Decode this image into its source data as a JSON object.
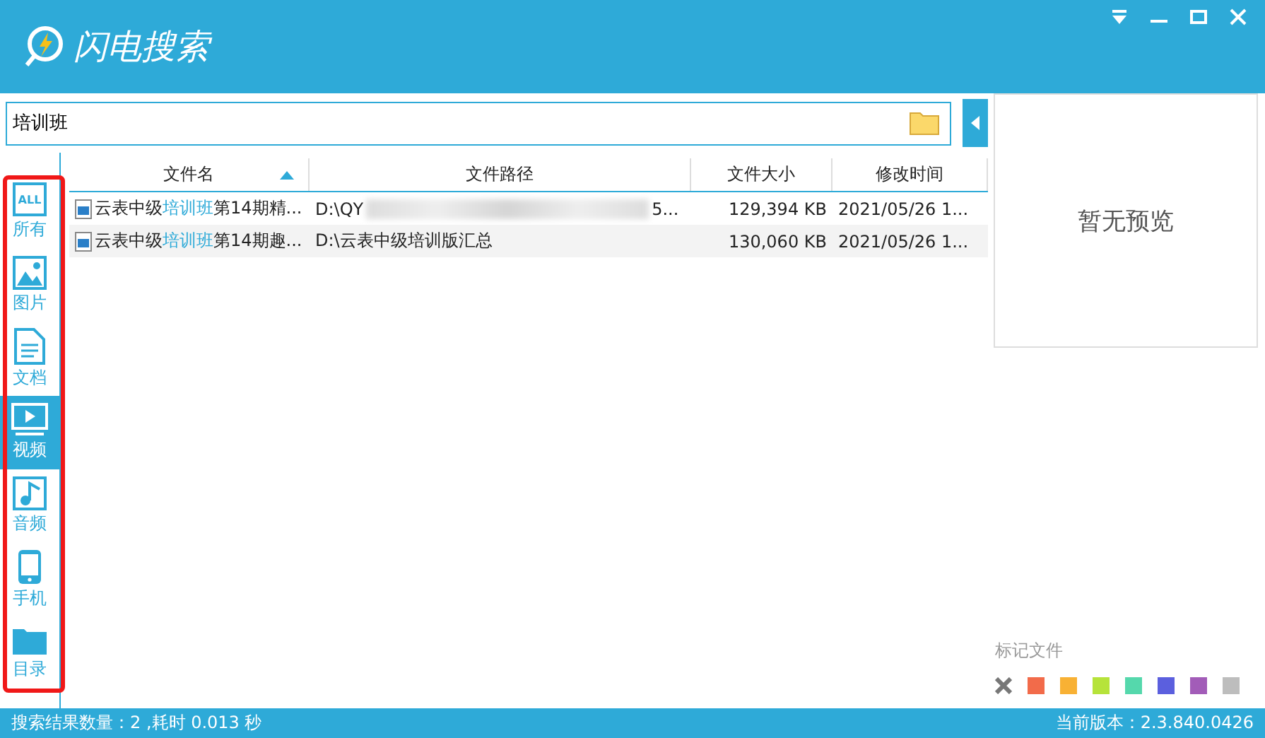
{
  "window": {
    "title": "闪电搜索"
  },
  "search": {
    "value": "培训班"
  },
  "sidebar": {
    "items": [
      {
        "label": "所有",
        "icon_text": "ALL",
        "selected": false
      },
      {
        "label": "图片",
        "selected": false
      },
      {
        "label": "文档",
        "selected": false
      },
      {
        "label": "视频",
        "selected": true
      },
      {
        "label": "音频",
        "selected": false
      },
      {
        "label": "手机",
        "selected": false
      },
      {
        "label": "目录",
        "selected": false
      }
    ]
  },
  "table": {
    "columns": [
      {
        "label": "文件名",
        "sorted": true
      },
      {
        "label": "文件路径",
        "sorted": false
      },
      {
        "label": "文件大小",
        "sorted": false
      },
      {
        "label": "修改时间",
        "sorted": false
      }
    ],
    "rows": [
      {
        "name": [
          "云表中级",
          "培训班",
          "第14期精..."
        ],
        "path": "D:\\QY",
        "path_blurred": true,
        "path_end": "5...",
        "size": "129,394 KB",
        "time": "2021/05/26 1..."
      },
      {
        "name": [
          "云表中级",
          "培训班",
          "第14期趣..."
        ],
        "path": "D:\\云表中级培训版汇总",
        "size": "130,060 KB",
        "time": "2021/05/26 1..."
      }
    ]
  },
  "preview": {
    "text": "暂无预览"
  },
  "tags": {
    "label": "标记文件",
    "colors": [
      {
        "color": "#f26b4a"
      },
      {
        "color": "#f8b134"
      },
      {
        "color": "#b6e33a"
      },
      {
        "color": "#55d8ac"
      },
      {
        "color": "#5b5fde"
      },
      {
        "color": "#a25cb8"
      },
      {
        "color": "#bdbdbd"
      }
    ]
  },
  "status_bar": {
    "left": "搜索结果数量：2 ,耗时 0.013 秒",
    "right": "当前版本：2.3.840.0426"
  }
}
